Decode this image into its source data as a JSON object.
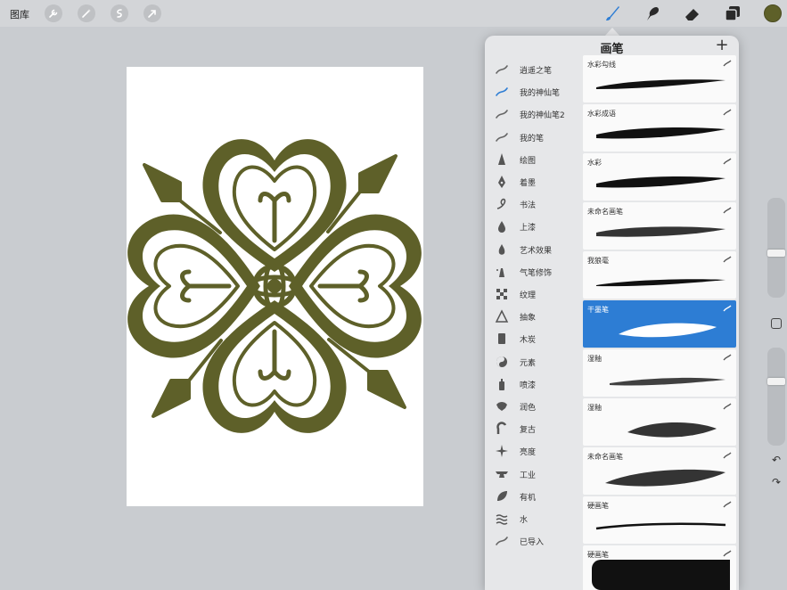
{
  "toolbar": {
    "gallery_label": "图库",
    "left_tools": [
      {
        "name": "wrench-icon"
      },
      {
        "name": "magic-wand-icon"
      },
      {
        "name": "selection-icon"
      },
      {
        "name": "transform-arrow-icon"
      }
    ],
    "right_tools": [
      {
        "name": "brush-icon",
        "color": "#2d7dd4"
      },
      {
        "name": "smudge-icon",
        "color": "#2a2a2a"
      },
      {
        "name": "eraser-icon",
        "color": "#2a2a2a"
      },
      {
        "name": "layers-icon",
        "color": "#2a2a2a"
      }
    ],
    "current_color": "#5e6029"
  },
  "canvas": {
    "background": "#ffffff",
    "artwork_color": "#5e6029"
  },
  "brush_panel": {
    "title": "画笔",
    "add_label": "+",
    "sets": [
      {
        "label": "逍遥之笔",
        "icon": "stroke-icon"
      },
      {
        "label": "我的神仙笔",
        "icon": "stroke-icon",
        "active": true
      },
      {
        "label": "我的神仙笔2",
        "icon": "stroke-icon"
      },
      {
        "label": "我的笔",
        "icon": "stroke-icon"
      },
      {
        "label": "绘图",
        "icon": "pencil-tip-icon"
      },
      {
        "label": "着墨",
        "icon": "pen-nib-icon"
      },
      {
        "label": "书法",
        "icon": "calligraphy-icon"
      },
      {
        "label": "上漆",
        "icon": "paint-drop-icon"
      },
      {
        "label": "艺术效果",
        "icon": "flame-drop-icon"
      },
      {
        "label": "气笔修饰",
        "icon": "airbrush-icon"
      },
      {
        "label": "纹理",
        "icon": "checker-icon"
      },
      {
        "label": "抽象",
        "icon": "triangle-icon"
      },
      {
        "label": "木炭",
        "icon": "charcoal-icon"
      },
      {
        "label": "元素",
        "icon": "yin-yang-icon"
      },
      {
        "label": "喷漆",
        "icon": "spray-can-icon"
      },
      {
        "label": "润色",
        "icon": "shell-icon"
      },
      {
        "label": "复古",
        "icon": "retro-arc-icon"
      },
      {
        "label": "亮度",
        "icon": "sparkle-icon"
      },
      {
        "label": "工业",
        "icon": "anvil-icon"
      },
      {
        "label": "有机",
        "icon": "leaf-icon"
      },
      {
        "label": "水",
        "icon": "waves-icon"
      },
      {
        "label": "已导入",
        "icon": "stroke-icon"
      }
    ],
    "brushes": [
      {
        "name": "水彩勾线",
        "style": "taper"
      },
      {
        "name": "水彩成语",
        "style": "taper-thick"
      },
      {
        "name": "水彩",
        "style": "taper-thick"
      },
      {
        "name": "未命名画笔",
        "style": "grainy"
      },
      {
        "name": "我狼毫",
        "style": "thin"
      },
      {
        "name": "干墨笔",
        "style": "dry",
        "selected": true
      },
      {
        "name": "湿釉",
        "style": "thin-grainy"
      },
      {
        "name": "湿釉",
        "style": "blotchy"
      },
      {
        "name": "未命名画笔",
        "style": "rough"
      },
      {
        "name": "硬画笔",
        "style": "line"
      },
      {
        "name": "硬画笔",
        "style": "block"
      }
    ]
  }
}
